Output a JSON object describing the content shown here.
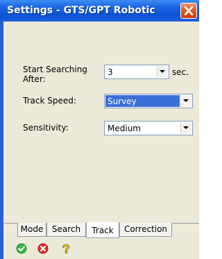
{
  "window": {
    "title": "Settings - GTS/GPT Robotic"
  },
  "form": {
    "start_search_label": "Start Searching After:",
    "start_search_value": "3",
    "start_search_unit": "sec.",
    "track_speed_label": "Track Speed:",
    "track_speed_value": "Survey",
    "sensitivity_label": "Sensitivity:",
    "sensitivity_value": "Medium"
  },
  "tabs": [
    {
      "label": "Mode"
    },
    {
      "label": "Search"
    },
    {
      "label": "Track",
      "active": true
    },
    {
      "label": "Correction"
    }
  ],
  "footer": {
    "ok_icon": "green-check-icon",
    "cancel_icon": "red-x-icon",
    "help_icon": "question-mark-icon"
  },
  "colors": {
    "title_bar": "#0b54d8",
    "client_bg": "#ece9d8",
    "selection": "#3a6fd8",
    "close_button": "#e2561f"
  }
}
